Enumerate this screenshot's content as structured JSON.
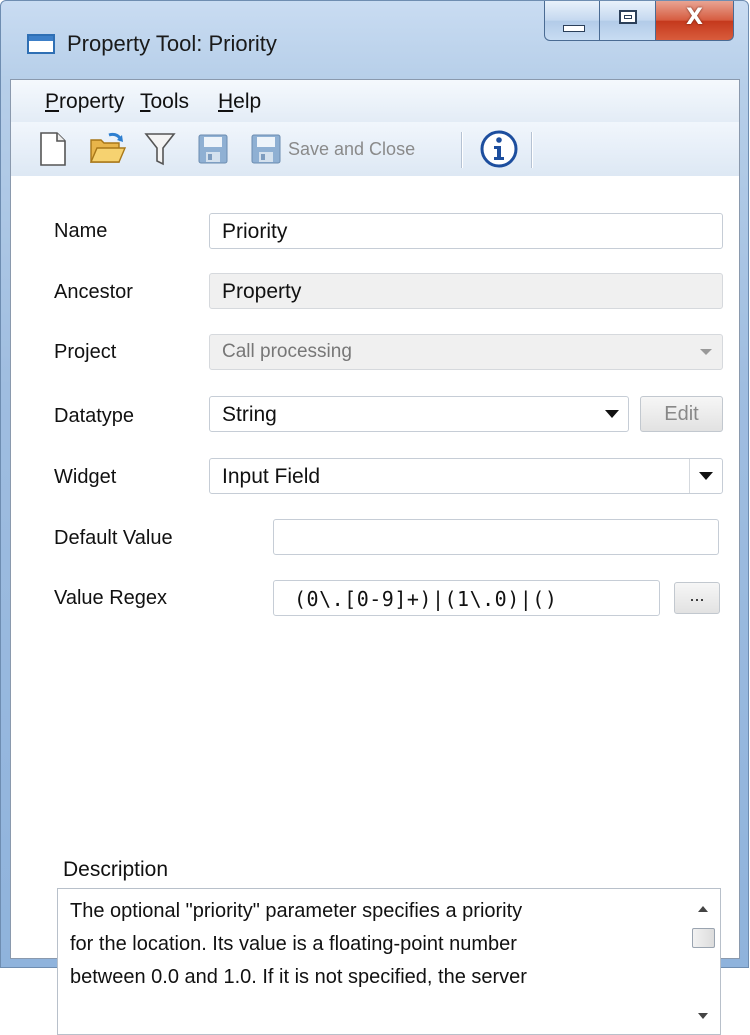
{
  "window": {
    "title": "Property Tool: Priority",
    "close_glyph": "X"
  },
  "menu": [
    {
      "underline": "P",
      "rest": "roperty"
    },
    {
      "underline": "T",
      "rest": "ools"
    },
    {
      "underline": "H",
      "rest": "elp"
    }
  ],
  "toolbar": {
    "save_close_label": "Save and Close"
  },
  "form": {
    "name": {
      "label": "Name",
      "value": "Priority"
    },
    "ancestor": {
      "label": "Ancestor",
      "value": "Property"
    },
    "project": {
      "label": "Project",
      "value": "Call processing"
    },
    "datatype": {
      "label": "Datatype",
      "value": "String",
      "edit_label": "Edit"
    },
    "widget": {
      "label": "Widget",
      "value": "Input Field"
    },
    "default_value": {
      "label": "Default Value",
      "value": ""
    },
    "value_regex": {
      "label": "Value Regex",
      "value": "(0\\.[0-9]+)|(1\\.0)|()",
      "browse_label": "..."
    },
    "description": {
      "label": "Description",
      "lines": [
        "The optional \"priority\" parameter specifies a priority",
        "for the location.  Its value is a floating-point number",
        "between 0.0 and 1.0. If it is not specified, the server"
      ]
    }
  }
}
